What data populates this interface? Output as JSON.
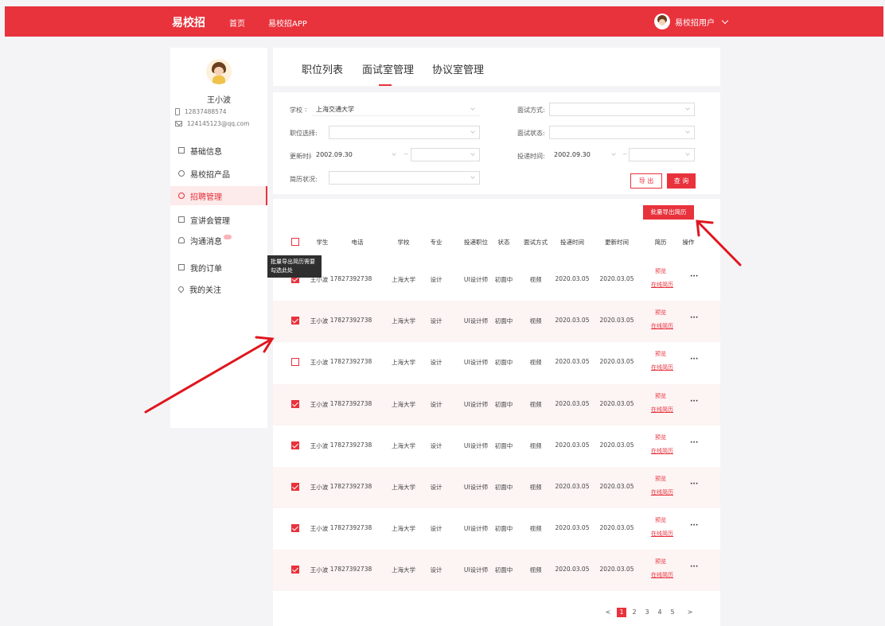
{
  "topbar": {
    "logo": "易校招",
    "nav": [
      "首页",
      "易校招APP"
    ],
    "user": "易校招用户"
  },
  "profile": {
    "name": "王小波",
    "phone": "12837488574",
    "email": "124145123@qq.com"
  },
  "menu": [
    {
      "label": "基础信息",
      "icon": "document-icon",
      "active": false
    },
    {
      "label": "易校招产品",
      "icon": "box-icon",
      "active": false
    },
    {
      "label": "招聘管理",
      "icon": "user-icon",
      "active": true
    },
    {
      "label": "宣讲会管理",
      "icon": "speaker-icon",
      "active": false
    },
    {
      "label": "沟通消息",
      "icon": "bell-icon",
      "active": false
    },
    {
      "label": "我的订单",
      "icon": "order-icon",
      "active": false
    },
    {
      "label": "我的关注",
      "icon": "heart-icon",
      "active": false
    }
  ],
  "tabs": [
    "职位列表",
    "面试室管理",
    "协议室管理"
  ],
  "active_tab": "面试室管理",
  "filters": {
    "school_label": "学校",
    "school_sep": ":",
    "school_value": "上海交通大学",
    "position_label": "职位选择:",
    "update_label": "更新时间:",
    "update_from": "2002.09.30",
    "resume_label": "简历状况:",
    "method_label": "面试方式:",
    "status_label": "面试状态:",
    "deliver_label": "投递时间:",
    "deliver_from": "2002.09.30",
    "range_sep": "~",
    "export_btn": "导 出",
    "query_btn": "查 询"
  },
  "batch_button": "批量导出简历",
  "tooltip": "批量导出简历需要勾选此处",
  "table": {
    "headers": [
      "学生",
      "电话",
      "学校",
      "专业",
      "投递职位",
      "状态",
      "面试方式",
      "投递时间",
      "更新时间",
      "简历",
      "操作"
    ],
    "rows": [
      {
        "checked": true,
        "student": "王小波",
        "phone": "17827392738",
        "school": "上海大学",
        "major": "设计",
        "position": "UI设计师",
        "status": "初面中",
        "method": "视频",
        "deliver": "2020.03.05",
        "update": "2020.03.05",
        "preview": "预览",
        "online": "在线简历",
        "more": "···"
      },
      {
        "checked": true,
        "student": "王小波",
        "phone": "17827392738",
        "school": "上海大学",
        "major": "设计",
        "position": "UI设计师",
        "status": "初面中",
        "method": "视频",
        "deliver": "2020.03.05",
        "update": "2020.03.05",
        "preview": "预览",
        "online": "在线简历",
        "more": "···"
      },
      {
        "checked": false,
        "student": "王小波",
        "phone": "17827392738",
        "school": "上海大学",
        "major": "设计",
        "position": "UI设计师",
        "status": "初面中",
        "method": "视频",
        "deliver": "2020.03.05",
        "update": "2020.03.05",
        "preview": "预览",
        "online": "在线简历",
        "more": "···"
      },
      {
        "checked": true,
        "student": "王小波",
        "phone": "17827392738",
        "school": "上海大学",
        "major": "设计",
        "position": "UI设计师",
        "status": "初面中",
        "method": "视频",
        "deliver": "2020.03.05",
        "update": "2020.03.05",
        "preview": "预览",
        "online": "在线简历",
        "more": "···"
      },
      {
        "checked": true,
        "student": "王小波",
        "phone": "17827392738",
        "school": "上海大学",
        "major": "设计",
        "position": "UI设计师",
        "status": "初面中",
        "method": "视频",
        "deliver": "2020.03.05",
        "update": "2020.03.05",
        "preview": "预览",
        "online": "在线简历",
        "more": "···"
      },
      {
        "checked": true,
        "student": "王小波",
        "phone": "17827392738",
        "school": "上海大学",
        "major": "设计",
        "position": "UI设计师",
        "status": "初面中",
        "method": "视频",
        "deliver": "2020.03.05",
        "update": "2020.03.05",
        "preview": "预览",
        "online": "在线简历",
        "more": "···"
      },
      {
        "checked": true,
        "student": "王小波",
        "phone": "17827392738",
        "school": "上海大学",
        "major": "设计",
        "position": "UI设计师",
        "status": "初面中",
        "method": "视频",
        "deliver": "2020.03.05",
        "update": "2020.03.05",
        "preview": "预览",
        "online": "在线简历",
        "more": "···"
      },
      {
        "checked": true,
        "student": "王小波",
        "phone": "17827392738",
        "school": "上海大学",
        "major": "设计",
        "position": "UI设计师",
        "status": "初面中",
        "method": "视频",
        "deliver": "2020.03.05",
        "update": "2020.03.05",
        "preview": "预览",
        "online": "在线简历",
        "more": "···"
      }
    ]
  },
  "pagination": {
    "prev": "<",
    "pages": [
      "1",
      "2",
      "3",
      "4",
      "5"
    ],
    "current": "1",
    "next": ">"
  },
  "colors": {
    "brand": "#e8323c",
    "row_highlight": "#fdf4f4"
  }
}
